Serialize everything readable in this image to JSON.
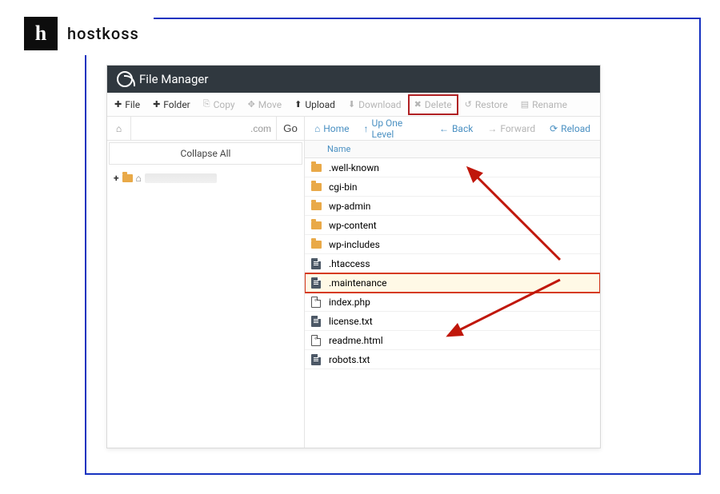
{
  "brand": {
    "logo_letter": "h",
    "name": "hostkoss"
  },
  "titlebar": {
    "title": "File Manager"
  },
  "toolbar": {
    "file": "File",
    "folder": "Folder",
    "copy": "Copy",
    "move": "Move",
    "upload": "Upload",
    "download": "Download",
    "delete": "Delete",
    "restore": "Restore",
    "rename": "Rename"
  },
  "left": {
    "path_value": ".com",
    "go": "Go",
    "collapse": "Collapse All",
    "tree_plus": "+"
  },
  "nav": {
    "home": "Home",
    "up": "Up One Level",
    "back": "Back",
    "forward": "Forward",
    "reload": "Reload"
  },
  "columns": {
    "name": "Name"
  },
  "files": [
    {
      "name": ".well-known",
      "type": "folder"
    },
    {
      "name": "cgi-bin",
      "type": "folder"
    },
    {
      "name": "wp-admin",
      "type": "folder"
    },
    {
      "name": "wp-content",
      "type": "folder"
    },
    {
      "name": "wp-includes",
      "type": "folder"
    },
    {
      "name": ".htaccess",
      "type": "file-dark"
    },
    {
      "name": ".maintenance",
      "type": "file-dark",
      "highlight": true
    },
    {
      "name": "index.php",
      "type": "file-code"
    },
    {
      "name": "license.txt",
      "type": "file-dark"
    },
    {
      "name": "readme.html",
      "type": "file-code"
    },
    {
      "name": "robots.txt",
      "type": "file-dark"
    }
  ]
}
